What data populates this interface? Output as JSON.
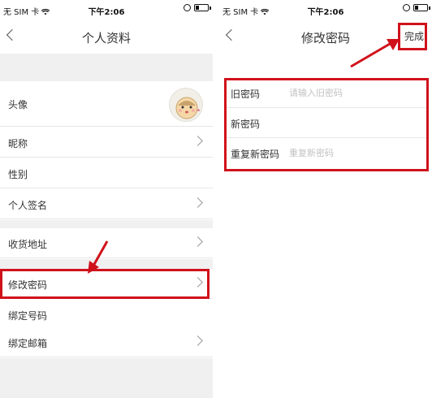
{
  "status_bar": {
    "carrier": "无 SIM 卡",
    "time": "下午2:06"
  },
  "profile": {
    "nav_title": "个人资料",
    "rows": {
      "avatar": "头像",
      "nickname": "昵称",
      "gender": "性别",
      "signature": "个人签名",
      "address": "收货地址",
      "change_password": "修改密码",
      "bind_phone": "绑定号码",
      "bind_email": "绑定邮箱"
    }
  },
  "change_password": {
    "nav_title": "修改密码",
    "done_label": "完成",
    "fields": {
      "old_label": "旧密码",
      "old_placeholder": "请输入旧密码",
      "new_label": "新密码",
      "repeat_label": "重复新密码",
      "repeat_placeholder": "重复新密码"
    }
  },
  "colors": {
    "highlight": "#d0121b",
    "section_gray": "#f0f0f0"
  }
}
